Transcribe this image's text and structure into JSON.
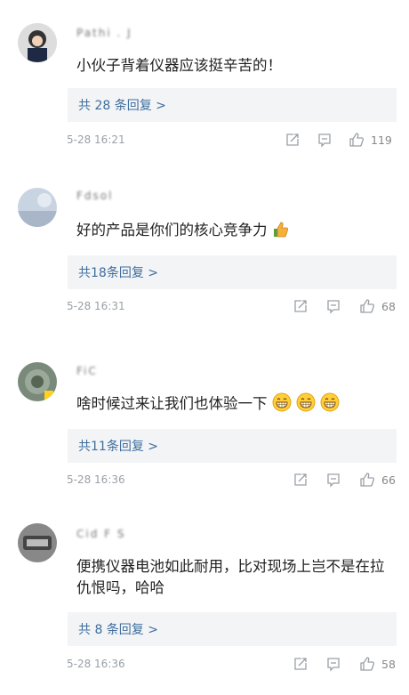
{
  "comments": [
    {
      "username": "Pathi . J",
      "text": "小伙子背着仪器应该挺辛苦的！",
      "replies": "共 28 条回复 >",
      "time": "5-28 16:21",
      "likes": "119"
    },
    {
      "username": "Fdsol",
      "text": "好的产品是你们的核心竞争力",
      "replies": "共18条回复 >",
      "time": "5-28 16:31",
      "likes": "68"
    },
    {
      "username": "FiC",
      "text": "啥时候过来让我们也体验一下",
      "replies": "共11条回复 >",
      "time": "5-28 16:36",
      "likes": "66"
    },
    {
      "username": "Cid F S",
      "text": "便携仪器电池如此耐用，比对现场上岂不是在拉仇恨吗，哈哈",
      "replies": "共 8 条回复 >",
      "time": "5-28 16:36",
      "likes": "58"
    }
  ],
  "icons": {
    "share": "share-icon",
    "comment": "comment-icon",
    "like": "thumbs-up-icon",
    "thumbs_emoji": "thumbs-up-emoji",
    "grin_emoji": "grin-emoji"
  },
  "colors": {
    "reply_link": "#3e6e9e",
    "reply_bg": "#f3f4f6",
    "meta_text": "#9aa0a6"
  }
}
